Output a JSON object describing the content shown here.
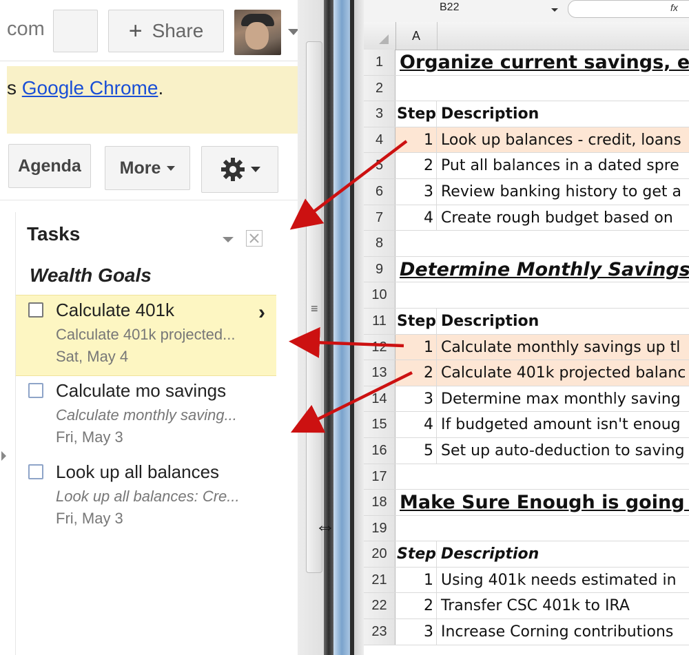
{
  "calendar": {
    "domain_fragment": "com",
    "share_label": "Share",
    "share_plus": "+",
    "banner": {
      "prefix": "s ",
      "link": "Google Chrome",
      "suffix": "."
    },
    "buttons": {
      "agenda": "Agenda",
      "more": "More"
    }
  },
  "tasks": {
    "title": "Tasks",
    "list_name": "Wealth Goals",
    "items": [
      {
        "title": "Calculate 401k",
        "note": "Calculate 401k projected...",
        "date": "Sat, May 4",
        "selected": true
      },
      {
        "title": "Calculate mo savings",
        "note": "Calculate monthly saving...",
        "date": "Fri, May 3",
        "selected": false
      },
      {
        "title": "Look up all balances",
        "note": "Look up all balances: Cre...",
        "date": "Fri, May 3",
        "selected": false
      }
    ]
  },
  "excel": {
    "name_box": "B22",
    "fx": "fx",
    "column_a": "A",
    "rows": [
      {
        "n": "1",
        "type": "heading",
        "text": "Organize current savings, ex"
      },
      {
        "n": "2",
        "type": "blank"
      },
      {
        "n": "3",
        "type": "header",
        "step": "Step",
        "desc": "Description"
      },
      {
        "n": "4",
        "type": "step",
        "step": "1",
        "desc": "Look up balances - credit, loans",
        "hl": true
      },
      {
        "n": "5",
        "type": "step",
        "step": "2",
        "desc": "Put all balances in a dated spre"
      },
      {
        "n": "6",
        "type": "step",
        "step": "3",
        "desc": "Review banking history to get a"
      },
      {
        "n": "7",
        "type": "step",
        "step": "4",
        "desc": "Create rough budget based on"
      },
      {
        "n": "8",
        "type": "blank"
      },
      {
        "n": "9",
        "type": "heading",
        "text": "Determine Monthly Savings",
        "italic": true
      },
      {
        "n": "10",
        "type": "blank"
      },
      {
        "n": "11",
        "type": "header",
        "step": "Step",
        "desc": "Description"
      },
      {
        "n": "12",
        "type": "step",
        "step": "1",
        "desc": "Calculate monthly savings up tl",
        "hl": true
      },
      {
        "n": "13",
        "type": "step",
        "step": "2",
        "desc": "Calculate 401k projected balanc",
        "hl": true
      },
      {
        "n": "14",
        "type": "step",
        "step": "3",
        "desc": "Determine max monthly saving"
      },
      {
        "n": "15",
        "type": "step",
        "step": "4",
        "desc": "If budgeted amount isn't enoug"
      },
      {
        "n": "16",
        "type": "step",
        "step": "5",
        "desc": "Set up auto-deduction to saving"
      },
      {
        "n": "17",
        "type": "blank"
      },
      {
        "n": "18",
        "type": "heading",
        "text": "Make Sure Enough is going in"
      },
      {
        "n": "19",
        "type": "blank"
      },
      {
        "n": "20",
        "type": "header",
        "step": "Step",
        "desc": "Description",
        "italic": true
      },
      {
        "n": "21",
        "type": "step",
        "step": "1",
        "desc": "Using 401k needs estimated in"
      },
      {
        "n": "22",
        "type": "step",
        "step": "2",
        "desc": "Transfer CSC 401k to IRA"
      },
      {
        "n": "23",
        "type": "step",
        "step": "3",
        "desc": "Increase Corning contributions"
      }
    ]
  },
  "colors": {
    "annotation_arrow": "#cc1111",
    "row_highlight": "#fde6d4",
    "selected_task": "#fdf6c2",
    "link": "#1a4fd6"
  }
}
